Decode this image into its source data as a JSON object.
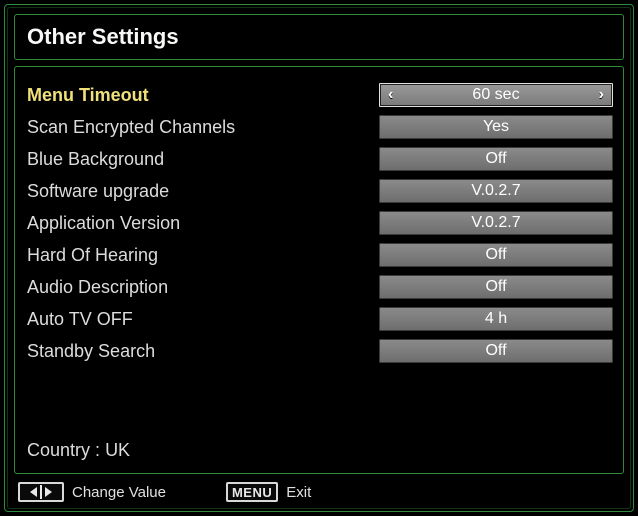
{
  "title": "Other Settings",
  "settings": [
    {
      "label": "Menu Timeout",
      "value": "60 sec",
      "selected": true
    },
    {
      "label": "Scan Encrypted Channels",
      "value": "Yes",
      "selected": false
    },
    {
      "label": "Blue Background",
      "value": "Off",
      "selected": false
    },
    {
      "label": "Software upgrade",
      "value": "V.0.2.7",
      "selected": false
    },
    {
      "label": "Application Version",
      "value": "V.0.2.7",
      "selected": false
    },
    {
      "label": "Hard Of Hearing",
      "value": "Off",
      "selected": false
    },
    {
      "label": "Audio Description",
      "value": "Off",
      "selected": false
    },
    {
      "label": "Auto TV OFF",
      "value": "4 h",
      "selected": false
    },
    {
      "label": "Standby Search",
      "value": "Off",
      "selected": false
    }
  ],
  "country_label": "Country",
  "country_value": "UK",
  "hints": {
    "change_value": "Change Value",
    "menu_key": "MENU",
    "exit": "Exit"
  }
}
